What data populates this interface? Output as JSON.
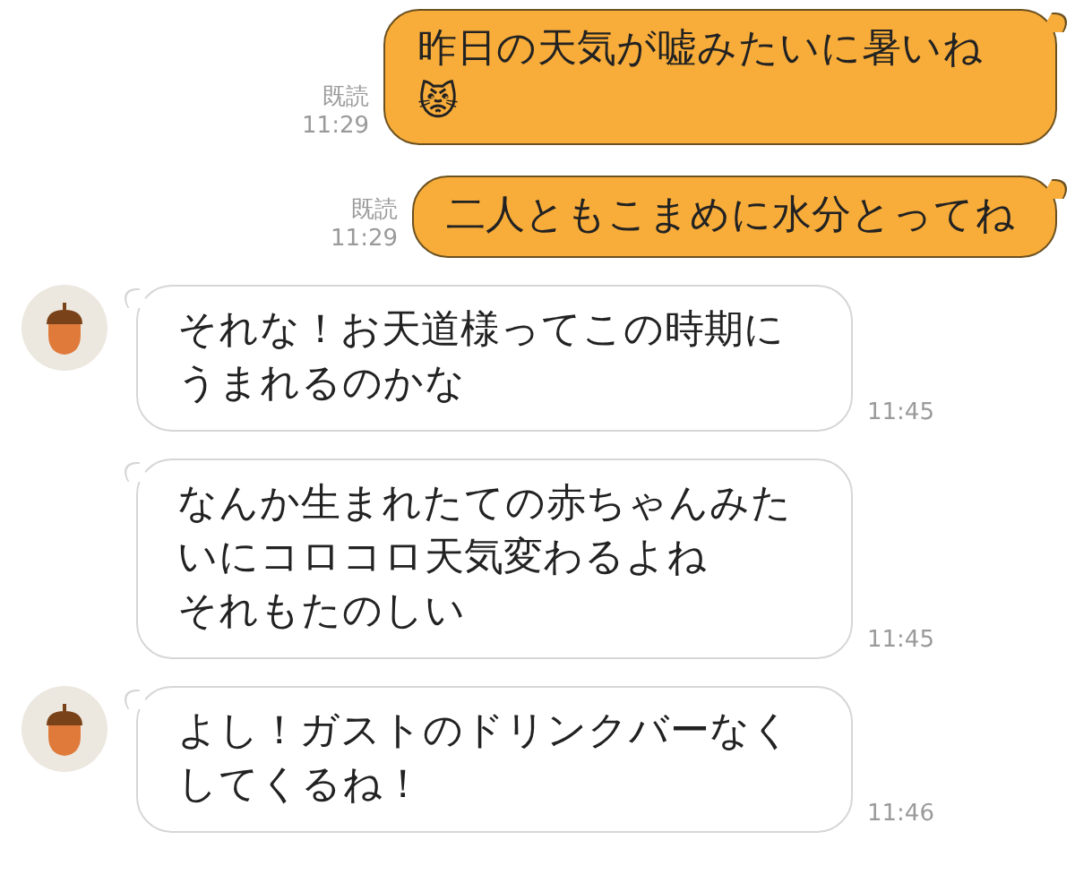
{
  "messages": [
    {
      "kind": "outgoing",
      "paragraphs": [
        "昨日の天気が嘘みたいに暑いね😾"
      ],
      "read_label": "既読",
      "time": "11:29"
    },
    {
      "kind": "outgoing",
      "paragraphs": [
        "二人ともこまめに水分とってね"
      ],
      "read_label": "既読",
      "time": "11:29"
    },
    {
      "kind": "incoming",
      "avatar": true,
      "paragraphs": [
        "それな！お天道様ってこの時期にうまれるのかな"
      ],
      "time": "11:45"
    },
    {
      "kind": "incoming",
      "avatar": false,
      "paragraphs": [
        "なんか生まれたての赤ちゃんみたいにコロコロ天気変わるよね",
        "それもたのしい"
      ],
      "time": "11:45"
    },
    {
      "kind": "incoming",
      "avatar": true,
      "paragraphs": [
        "よし！ガストのドリンクバーなくしてくるね！"
      ],
      "time": "11:46"
    }
  ]
}
